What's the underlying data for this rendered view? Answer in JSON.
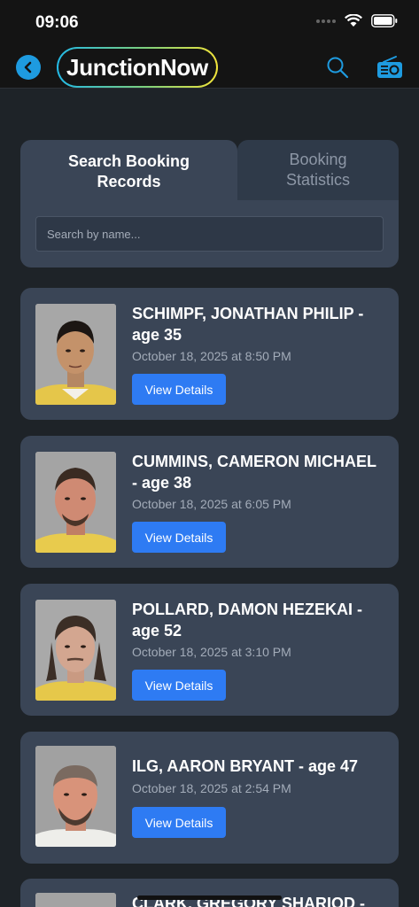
{
  "status_bar": {
    "time": "09:06"
  },
  "header": {
    "logo_text": "JunctionNow"
  },
  "tabs": [
    {
      "label": "Search Booking Records",
      "active": true
    },
    {
      "label": "Booking Statistics",
      "active": false
    }
  ],
  "search": {
    "placeholder": "Search by name..."
  },
  "colors": {
    "accent": "#2e7bf3",
    "card": "#3a4556",
    "background": "#1e2328",
    "logo_gradient": [
      "#23b9e6",
      "#f2e43a"
    ]
  },
  "records": [
    {
      "name": "SCHIMPF, JONATHAN PHILIP - age 35",
      "date": "October 18, 2025 at 8:50 PM",
      "button": "View Details"
    },
    {
      "name": "CUMMINS, CAMERON MICHAEL - age 38",
      "date": "October 18, 2025 at 6:05 PM",
      "button": "View Details"
    },
    {
      "name": "POLLARD, DAMON HEZEKAI - age 52",
      "date": "October 18, 2025 at 3:10 PM",
      "button": "View Details"
    },
    {
      "name": "ILG, AARON BRYANT - age 47",
      "date": "October 18, 2025 at 2:54 PM",
      "button": "View Details"
    },
    {
      "name": "CLARK, GREGORY SHARIOD -"
    }
  ]
}
